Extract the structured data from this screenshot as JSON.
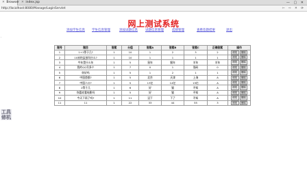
{
  "browser": {
    "tabs": [
      {
        "label": "Browser",
        "active": true
      },
      {
        "label": "index.jsp",
        "active": false
      }
    ],
    "window_controls": "— ▢ ✕",
    "url": "http://localhost:8080/Manage/LoginServlet",
    "address_controls": "⇦ ⇨ ✕ ⟳"
  },
  "page": {
    "title": "网上测试系统",
    "nav": [
      "添加学生信息",
      "学生信息管理",
      "添加试题信息",
      "试题信息管理",
      "成绩管理",
      "查看答题结果",
      "退出"
    ],
    "gutter_mark": "·",
    "watermark": [
      "工具",
      "修机"
    ]
  },
  "table": {
    "headers": [
      "题号",
      "题目",
      "答案",
      "分值",
      "答案A",
      "答案B",
      "答案C",
      "正确答案",
      "操作"
    ],
    "rows": [
      [
        "1",
        "1+1等于几?",
        "1",
        "10",
        "1",
        "2",
        "3",
        "2"
      ],
      [
        "2",
        "10米的女孩叫什么?",
        "1",
        "10",
        "1",
        "1",
        "1",
        "1"
      ],
      [
        "3",
        "今年是什么年",
        "1",
        "5",
        "鼠年",
        "猴年",
        "羊年",
        "羊年"
      ],
      [
        "4",
        "我的QQ号多少",
        "1",
        "7",
        "0",
        "1",
        "强码",
        "0"
      ],
      [
        "5",
        "你好吗",
        "1",
        "5",
        "1",
        "2",
        "1",
        "1"
      ],
      [
        "6",
        "中国首都?",
        "1",
        "5",
        "北京",
        "天津",
        "上海",
        "A"
      ],
      [
        "7",
        "中国人口?",
        "1",
        "5",
        "13亿",
        "14亿",
        "15亿",
        "A"
      ],
      [
        "8",
        "2等于几",
        "1",
        "6",
        "好",
        "猫",
        "不知",
        "A"
      ],
      [
        "9",
        "你喜欢看电影吗",
        "1",
        "5",
        "好",
        "猫",
        "不知",
        "A"
      ],
      [
        "10",
        "今天下雨了吗?",
        "1",
        "11",
        "没下",
        "下了",
        "不知",
        "A"
      ],
      [
        "11",
        "11",
        "1",
        "22",
        "33",
        "44",
        "55",
        "3"
      ]
    ],
    "op_modify": "修改",
    "op_delete": "删除"
  }
}
